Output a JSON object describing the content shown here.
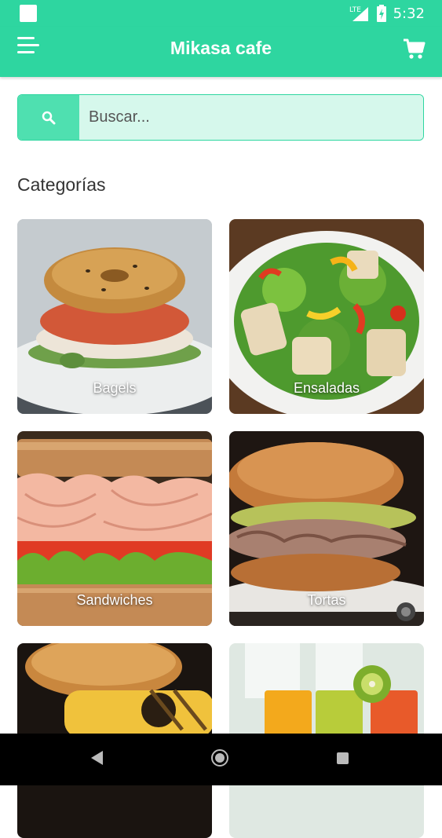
{
  "status_bar": {
    "time": "5:32",
    "network": "LTE"
  },
  "app_bar": {
    "title": "Mikasa cafe",
    "menu_icon": "menu-icon",
    "cart_icon": "cart-icon"
  },
  "search": {
    "placeholder": "Buscar...",
    "value": "",
    "icon": "search-icon"
  },
  "categories": {
    "title": "Categorías",
    "items": [
      {
        "label": "Bagels"
      },
      {
        "label": "Ensaladas"
      },
      {
        "label": "Sandwiches"
      },
      {
        "label": "Tortas"
      },
      {
        "label": ""
      },
      {
        "label": ""
      }
    ]
  },
  "colors": {
    "primary": "#2ed6a0",
    "search_bg": "#d6f8ec",
    "search_button": "#4fe0b0"
  }
}
